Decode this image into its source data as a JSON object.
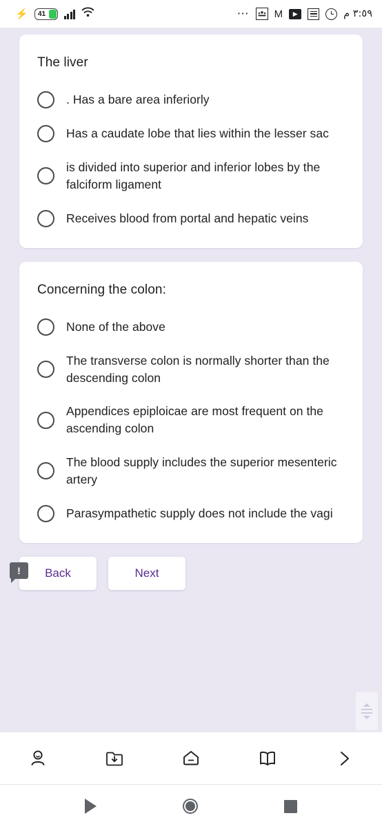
{
  "statusbar": {
    "charging_icon": "bolt-icon",
    "battery_level": "41",
    "signal_icon": "cellular-signal-icon",
    "wifi_icon": "wifi-icon",
    "overflow_icon": "more-dots-icon",
    "notification_icons": [
      "classroom-icon",
      "gmail-icon",
      "youtube-icon",
      "news-icon",
      "alarm-icon"
    ],
    "time": "٣:٥٩ م"
  },
  "quiz": {
    "cards": [
      {
        "title": "The liver",
        "options": [
          ". Has a bare area inferiorly",
          "Has a caudate lobe that lies within the lesser sac",
          "is divided into superior and inferior lobes by the falciform ligament",
          "Receives blood from portal and hepatic veins"
        ]
      },
      {
        "title": "Concerning the colon:",
        "options": [
          "None of the above",
          "The transverse colon is normally shorter than the descending colon",
          "Appendices epiploicae are most frequent on the ascending colon",
          "The blood supply includes the superior mesenteric artery",
          "Parasympathetic supply does not include the vagi"
        ]
      }
    ],
    "buttons": {
      "back_label": "Back",
      "next_label": "Next",
      "feedback_badge": "!"
    },
    "accent_color": "#5b2d90",
    "background_color": "#eae7f3"
  },
  "browser_nav": {
    "items": [
      {
        "icon": "account-icon"
      },
      {
        "icon": "downloads-folder-icon"
      },
      {
        "icon": "home-icon"
      },
      {
        "icon": "bookmarks-book-icon"
      },
      {
        "icon": "forward-chevron-icon"
      }
    ]
  },
  "system_nav": {
    "items": [
      {
        "icon": "android-back-icon"
      },
      {
        "icon": "android-home-icon"
      },
      {
        "icon": "android-recents-icon"
      }
    ]
  }
}
